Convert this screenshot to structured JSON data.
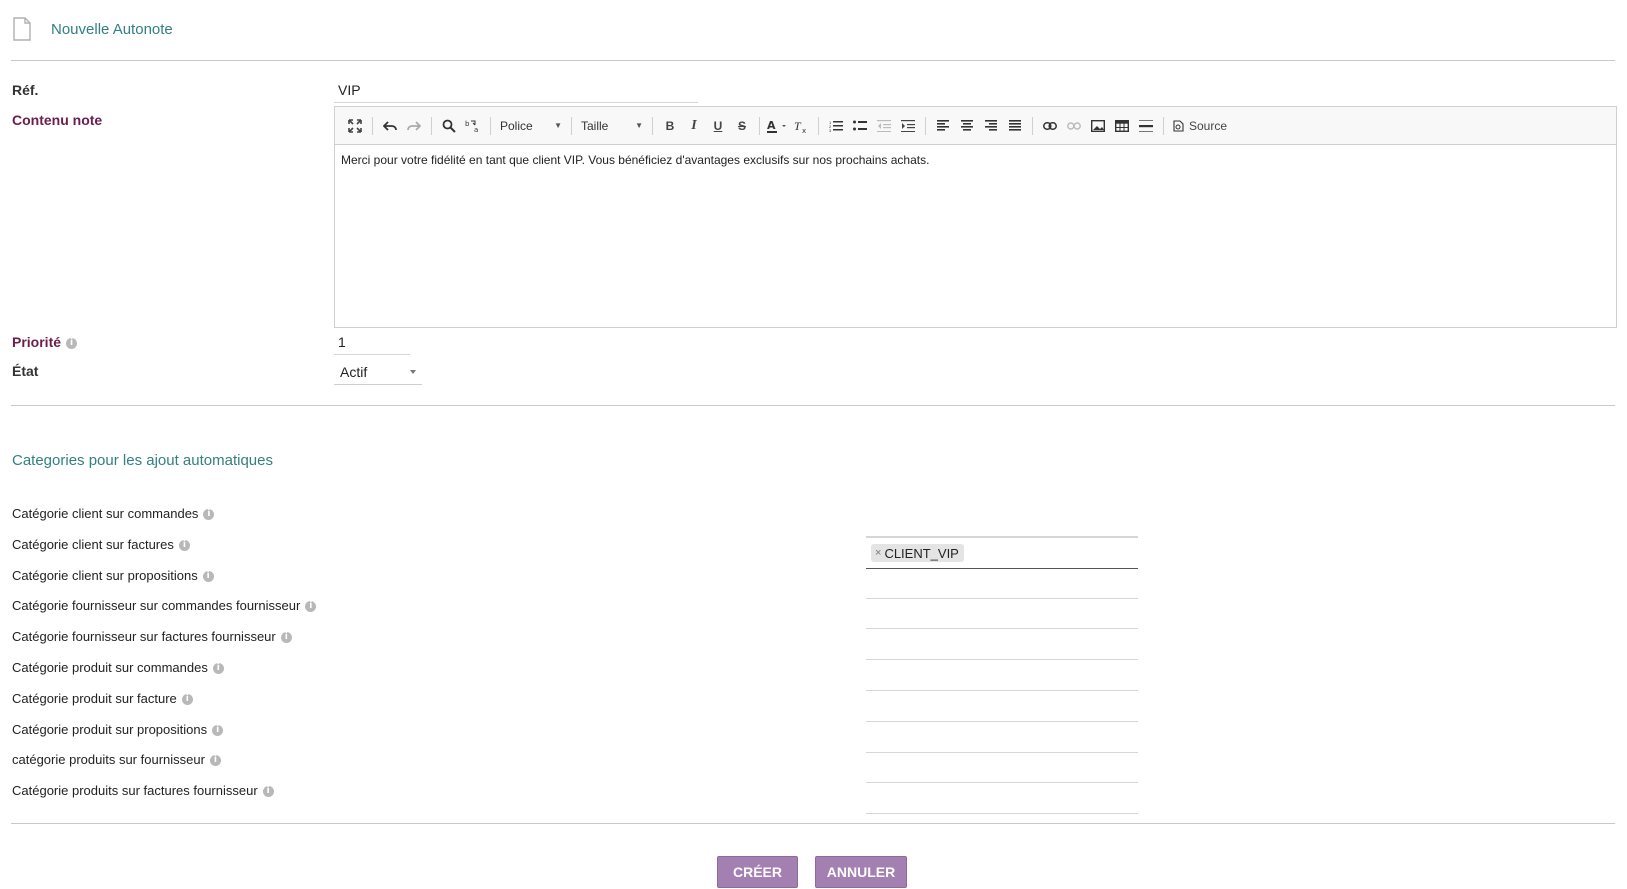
{
  "header": {
    "title": "Nouvelle Autonote",
    "icon": "document-icon"
  },
  "form": {
    "ref_label": "Réf.",
    "ref_value": "VIP",
    "content_label": "Contenu note",
    "content_value": "Merci pour votre fidélité en tant que client VIP. Vous bénéficiez d'avantages exclusifs sur nos prochains achats.",
    "priority_label": "Priorité",
    "priority_value": "1",
    "state_label": "État",
    "state_value": "Actif"
  },
  "toolbar": {
    "font_label": "Police",
    "size_label": "Taille",
    "source_label": "Source",
    "bold": "B",
    "italic": "I",
    "underline": "U",
    "strike": "S"
  },
  "categories": {
    "title": "Categories pour les ajout automatiques",
    "items": [
      {
        "label": "Catégorie client sur commandes",
        "tags": []
      },
      {
        "label": "Catégorie client sur factures",
        "tags": [
          "CLIENT_VIP"
        ]
      },
      {
        "label": "Catégorie client sur propositions",
        "tags": []
      },
      {
        "label": "Catégorie fournisseur sur commandes fournisseur",
        "tags": []
      },
      {
        "label": "Catégorie fournisseur sur factures fournisseur",
        "tags": []
      },
      {
        "label": "Catégorie produit sur commandes",
        "tags": []
      },
      {
        "label": "Catégorie produit sur facture",
        "tags": []
      },
      {
        "label": "Catégorie produit sur propositions",
        "tags": []
      },
      {
        "label": "catégorie produits sur fournisseur",
        "tags": []
      },
      {
        "label": "Catégorie produits sur factures fournisseur",
        "tags": []
      }
    ],
    "tag_remove_symbol": "×"
  },
  "actions": {
    "create_label": "CRÉER",
    "cancel_label": "ANNULER"
  },
  "colors": {
    "accent_title": "#337f83",
    "button": "#a47fb2",
    "label": "#6b1e4c"
  }
}
